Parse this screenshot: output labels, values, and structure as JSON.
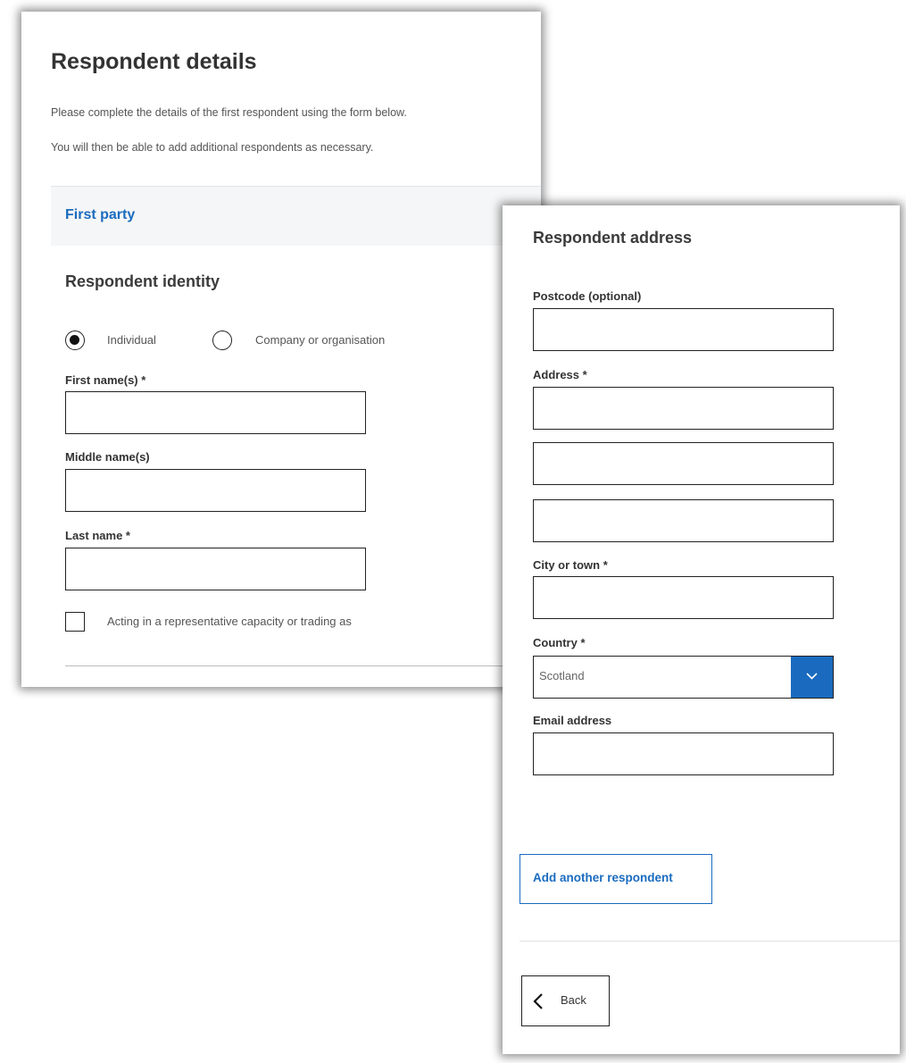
{
  "respondent_details": {
    "title": "Respondent details",
    "intro_line_1": "Please complete the details of the first respondent using the form below.",
    "intro_line_2": "You will then be able to add additional respondents as necessary.",
    "party_label": "First party",
    "identity_heading": "Respondent identity",
    "type_options": [
      {
        "label": "Individual",
        "selected": true
      },
      {
        "label": "Company or organisation",
        "selected": false
      }
    ],
    "fields": {
      "first_name": {
        "label": "First name(s) *",
        "value": ""
      },
      "middle_name": {
        "label": "Middle name(s)",
        "value": ""
      },
      "last_name": {
        "label": "Last name *",
        "value": ""
      }
    },
    "representative_checkbox": {
      "label": "Acting in a representative capacity or trading as",
      "checked": false
    }
  },
  "respondent_address": {
    "heading": "Respondent address",
    "postcode": {
      "label": "Postcode (optional)",
      "value": ""
    },
    "address": {
      "label": "Address *",
      "lines": [
        "",
        "",
        ""
      ]
    },
    "city": {
      "label": "City or town *",
      "value": ""
    },
    "country": {
      "label": "Country *",
      "selected": "Scotland",
      "icon": "chevron-down-icon"
    },
    "email": {
      "label": "Email address",
      "value": ""
    },
    "add_button_label": "Add another respondent",
    "back_button": {
      "label": "Back",
      "icon": "chevron-left-icon"
    }
  },
  "colors": {
    "accent": "#1a6bbf",
    "text": "#333333",
    "party_bar_bg": "#f5f6f7"
  }
}
